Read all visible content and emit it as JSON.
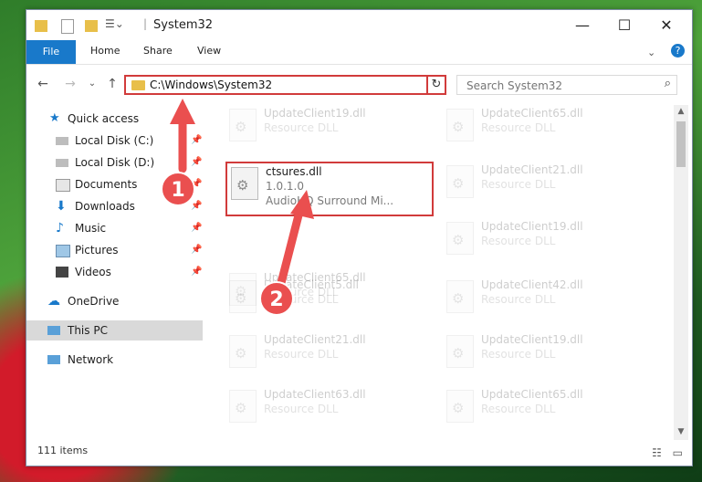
{
  "window": {
    "title": "System32",
    "minimize": "—",
    "maximize": "☐",
    "close": "✕"
  },
  "ribbon": {
    "file": "File",
    "home": "Home",
    "share": "Share",
    "view": "View",
    "help": "?"
  },
  "nav": {
    "back": "←",
    "forward": "→",
    "recent": "⌄",
    "up": "↑",
    "address": "C:\\Windows\\System32",
    "address_dropdown": "⌄",
    "refresh": "↻",
    "search_placeholder": "Search System32",
    "search_icon": "⌕"
  },
  "sidebar": {
    "items": [
      {
        "label": "Quick access",
        "icon": "star-icon",
        "pinned": false
      },
      {
        "label": "Local Disk (C:)",
        "icon": "drive-icon",
        "pinned": true
      },
      {
        "label": "Local Disk (D:)",
        "icon": "drive-icon",
        "pinned": true
      },
      {
        "label": "Documents",
        "icon": "documents-icon",
        "pinned": true
      },
      {
        "label": "Downloads",
        "icon": "download-icon",
        "pinned": true
      },
      {
        "label": "Music",
        "icon": "music-icon",
        "pinned": true
      },
      {
        "label": "Pictures",
        "icon": "pictures-icon",
        "pinned": true
      },
      {
        "label": "Videos",
        "icon": "videos-icon",
        "pinned": true
      },
      {
        "label": "OneDrive",
        "icon": "cloud-icon",
        "pinned": false
      },
      {
        "label": "This PC",
        "icon": "computer-icon",
        "pinned": false,
        "selected": true
      },
      {
        "label": "Network",
        "icon": "network-icon",
        "pinned": false
      }
    ],
    "pin_glyph": "📌"
  },
  "files": {
    "left": [
      {
        "name": "UpdateClient19.dll",
        "type": "Resource DLL"
      },
      {
        "name": "ctsures.dll",
        "version": "1.0.1.0",
        "desc": "AudioHQ Surround Mi..."
      },
      {
        "name": "UpdateClient65.dll",
        "type": "Resource DLL"
      },
      {
        "name": "UpdateClient5.dll",
        "type": "Resource DLL"
      },
      {
        "name": "UpdateClient21.dll",
        "type": "Resource DLL"
      },
      {
        "name": "UpdateClient63.dll",
        "type": "Resource DLL"
      }
    ],
    "right": [
      {
        "name": "UpdateClient65.dll",
        "type": "Resource DLL"
      },
      {
        "name": "UpdateClient21.dll",
        "type": "Resource DLL"
      },
      {
        "name": "UpdateClient19.dll",
        "type": "Resource DLL"
      },
      {
        "name": "UpdateClient42.dll",
        "type": "Resource DLL"
      },
      {
        "name": "UpdateClient19.dll",
        "type": "Resource DLL"
      },
      {
        "name": "UpdateClient65.dll",
        "type": "Resource DLL"
      }
    ]
  },
  "status": {
    "count": "111 items",
    "details_view": "☷",
    "tiles_view": "▭"
  },
  "callouts": {
    "one": "1",
    "two": "2"
  },
  "colors": {
    "accent": "#1979ca",
    "highlight": "#d13b3b",
    "callout": "#ea4f4f"
  }
}
